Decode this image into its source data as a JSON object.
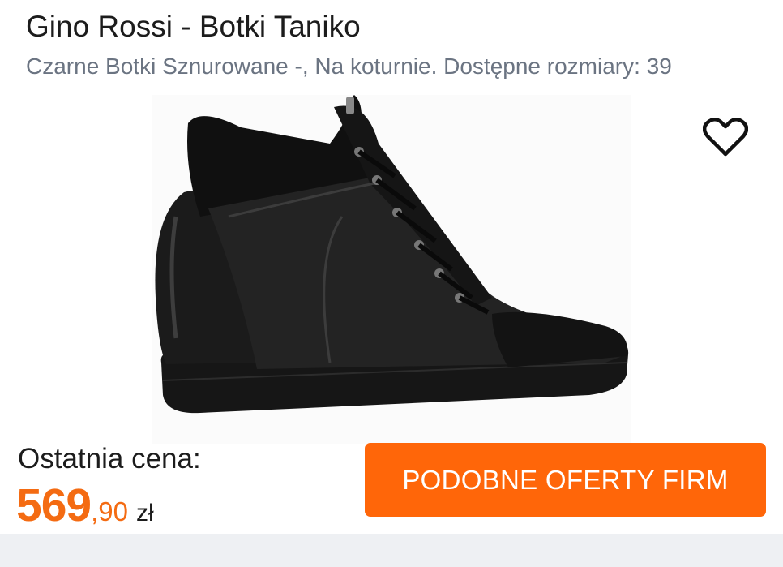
{
  "product": {
    "title": "Gino Rossi - Botki Taniko",
    "description": "Czarne Botki Sznurowane -, Na koturnie. Dostępne rozmiary: 39",
    "image_alt": "black wedge sneaker boot"
  },
  "icons": {
    "favorite": "heart-outline-icon"
  },
  "pricing": {
    "label": "Ostatnia cena:",
    "whole": "569",
    "cents": ",90",
    "currency": "zł",
    "accent_color": "#f46b12"
  },
  "cta": {
    "label": "PODOBNE OFERTY FIRM",
    "color": "#ff6609"
  }
}
